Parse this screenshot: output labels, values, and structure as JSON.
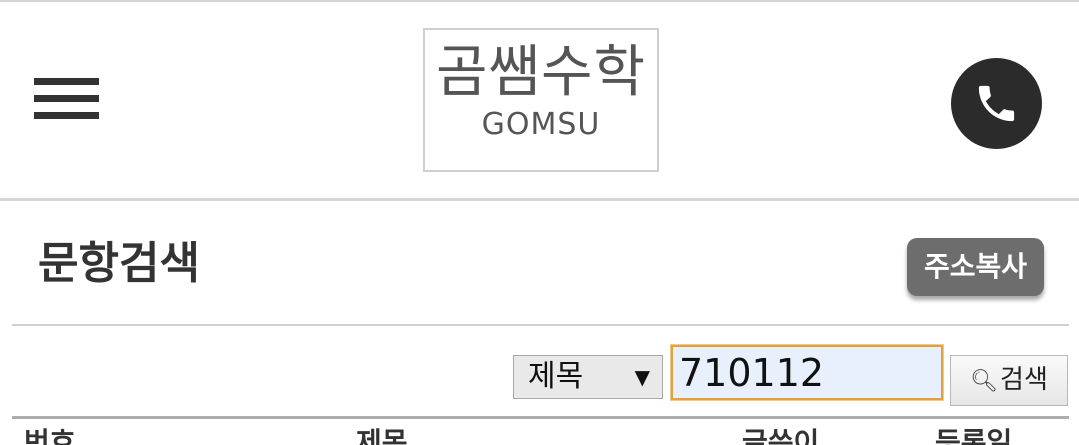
{
  "header": {
    "logo_title": "곰쌤수학",
    "logo_sub": "GOMSU"
  },
  "page": {
    "title": "문항검색",
    "copy_button": "주소복사"
  },
  "search": {
    "field_selected": "제목",
    "field_arrow": "▼",
    "query_value": "710112",
    "button_label": "검색",
    "button_icon": "magnifier-icon"
  },
  "table": {
    "headers": [
      "번호",
      "제목",
      "글쓴이",
      "등록일"
    ]
  },
  "colors": {
    "icon_dark": "#2b2b2b",
    "copy_button_bg": "#6d6d6d",
    "input_focus_border": "#e1a23c",
    "input_bg": "#e8f0fe"
  }
}
